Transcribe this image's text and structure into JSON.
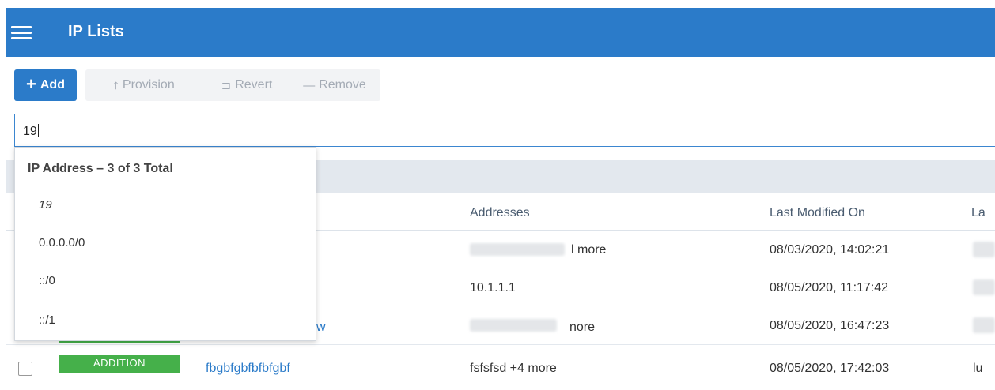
{
  "header": {
    "title": "IP Lists",
    "menu_icon": "hamburger-menu-icon",
    "color": "#2b7bc9"
  },
  "toolbar": {
    "add": {
      "icon": "+",
      "label": "Add"
    },
    "provision": {
      "icon": "⤒",
      "label": "Provision"
    },
    "revert": {
      "icon": "⊐",
      "label": "Revert"
    },
    "remove": {
      "icon": "—",
      "label": "Remove"
    }
  },
  "search": {
    "value": "19"
  },
  "dropdown": {
    "header": "IP Address – 3 of 3 Total",
    "items": [
      "19",
      "0.0.0.0/0",
      "::/0",
      "::/1"
    ]
  },
  "table": {
    "columns": {
      "addresses": "Addresses",
      "last_modified": "Last Modified On",
      "last_by": "La"
    },
    "rows": [
      {
        "addresses_tail": "l more",
        "modified": "08/03/2020, 14:02:21"
      },
      {
        "addresses": "10.1.1.1",
        "modified": "08/05/2020, 11:17:42"
      },
      {
        "name_tail": "w",
        "addresses_tail": "nore",
        "modified": "08/05/2020, 16:47:23"
      },
      {
        "badge": "ADDITION",
        "name": "fbgbfgbfbfbfgbf",
        "addresses": "fsfsfsd +4 more",
        "modified": "08/05/2020, 17:42:03",
        "by": "lu"
      }
    ]
  },
  "colors": {
    "accent": "#2b7bc9",
    "addition_badge": "#45b04a"
  }
}
